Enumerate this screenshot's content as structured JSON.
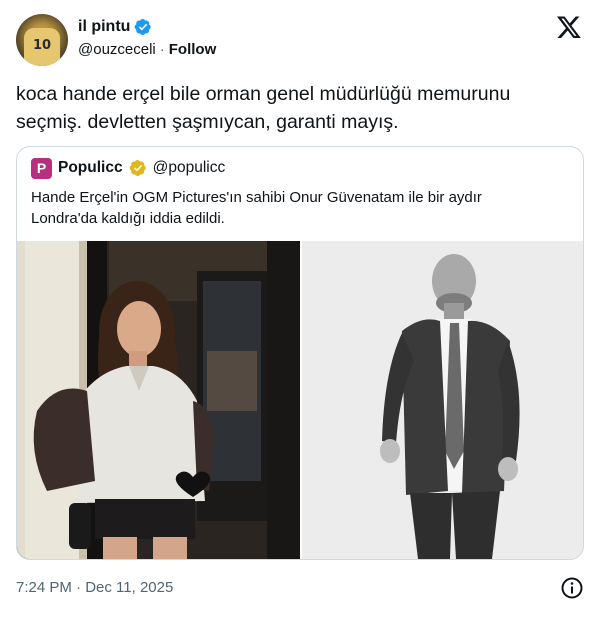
{
  "author": {
    "display_name": "il pintu",
    "handle": "@ouzceceli",
    "separator": "·",
    "follow_label": "Follow",
    "avatar_number": "10"
  },
  "tweet": {
    "lines": [
      "koca hande erçel bile orman genel müdürlüğü memurunu",
      "seçmiş. devletten şaşmıycan, garanti mayış."
    ]
  },
  "quote": {
    "avatar_letter": "P",
    "display_name": "Populicc",
    "handle": "@populicc",
    "lines": [
      "Hande Erçel'in OGM Pictures'ın sahibi Onur Güvenatam ile bir aydır",
      "Londra'da kaldığı iddia edildi."
    ]
  },
  "footer": {
    "timestamp": "7:24 PM · Dec 11, 2025"
  },
  "colors": {
    "text": "#0f1419",
    "secondary": "#536471",
    "border": "#cfd9de",
    "verified_blue": "#1d9bf0",
    "verified_gold": "#e2b719",
    "populicc_brand": "#b5307d"
  },
  "icons": {
    "x_logo": "x-logo-icon",
    "verified": "verified-badge-icon",
    "info": "info-icon"
  }
}
